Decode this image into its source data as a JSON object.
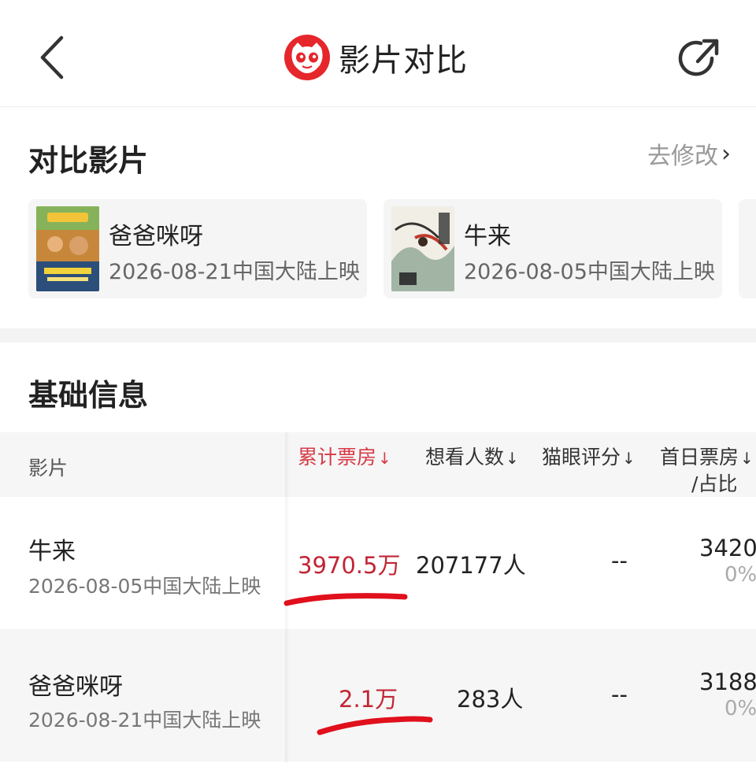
{
  "header": {
    "title": "影片对比",
    "back_icon": "chevron-left-icon",
    "share_icon": "share-icon",
    "logo_icon": "cat-eye-logo"
  },
  "compare": {
    "title": "对比影片",
    "edit_label": "去修改",
    "films": [
      {
        "name": "爸爸咪呀",
        "date": "2026-08-21中国大陆上映"
      },
      {
        "name": "牛来",
        "date": "2026-08-05中国大陆上映"
      }
    ]
  },
  "basic": {
    "title": "基础信息",
    "columns": {
      "film": "影片",
      "box_office": "累计票房",
      "want_see": "想看人数",
      "rating": "猫眼评分",
      "first_day": "首日票房",
      "first_day_share": "/占比",
      "sort_mark": "↓"
    },
    "rows": [
      {
        "name": "牛来",
        "date": "2026-08-05中国大陆上映",
        "box_office": "3970.5万",
        "want_see": "207177人",
        "rating": "--",
        "first_day": "3420",
        "first_day_share": "0%"
      },
      {
        "name": "爸爸咪呀",
        "date": "2026-08-21中国大陆上映",
        "box_office": "2.1万",
        "want_see": "283人",
        "rating": "--",
        "first_day": "3188",
        "first_day_share": "0%"
      }
    ]
  },
  "colors": {
    "accent": "#d63a46",
    "highlight_value": "#c22535",
    "annotation": "#e0101c",
    "logo": "#e5262b"
  }
}
